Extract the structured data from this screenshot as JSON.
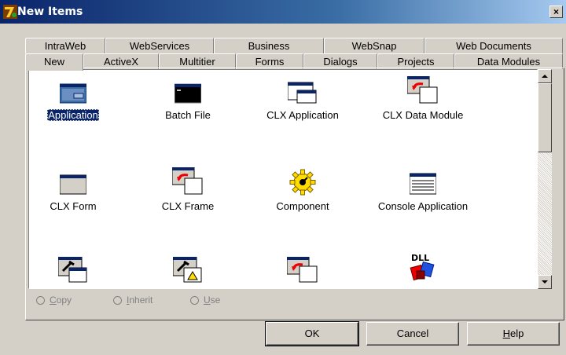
{
  "window": {
    "title": "New Items",
    "close_label": "×"
  },
  "tabs_row_back": [
    {
      "label": "IntraWeb"
    },
    {
      "label": "WebServices"
    },
    {
      "label": "Business"
    },
    {
      "label": "WebSnap"
    },
    {
      "label": "Web Documents"
    }
  ],
  "tabs_row_front": [
    {
      "label": "New",
      "active": true
    },
    {
      "label": "ActiveX"
    },
    {
      "label": "Multitier"
    },
    {
      "label": "Forms"
    },
    {
      "label": "Dialogs"
    },
    {
      "label": "Projects"
    },
    {
      "label": "Data Modules"
    }
  ],
  "items": [
    {
      "label": "Application",
      "icon": "application-icon",
      "selected": true
    },
    {
      "label": "Batch File",
      "icon": "batch-file-icon"
    },
    {
      "label": "CLX Application",
      "icon": "clx-application-icon"
    },
    {
      "label": "CLX Data Module",
      "icon": "clx-data-module-icon"
    },
    {
      "label": "CLX Form",
      "icon": "clx-form-icon"
    },
    {
      "label": "CLX Frame",
      "icon": "clx-frame-icon"
    },
    {
      "label": "Component",
      "icon": "component-gear-icon"
    },
    {
      "label": "Console Application",
      "icon": "console-application-icon"
    },
    {
      "label": "",
      "icon": "control-panel-application-icon"
    },
    {
      "label": "",
      "icon": "control-panel-module-icon"
    },
    {
      "label": "",
      "icon": "frame-icon"
    },
    {
      "label": "",
      "icon": "dll-icon"
    }
  ],
  "options": {
    "copy": {
      "accel": "C",
      "rest": "opy"
    },
    "inherit": {
      "accel": "I",
      "rest": "nherit"
    },
    "use": {
      "accel": "U",
      "rest": "se"
    }
  },
  "buttons": {
    "ok": "OK",
    "cancel": "Cancel",
    "help_accel": "H",
    "help_rest": "elp"
  },
  "colors": {
    "title_start": "#0a246a",
    "title_end": "#a6caf0",
    "selection": "#0a246a",
    "face": "#d4d0c8"
  }
}
